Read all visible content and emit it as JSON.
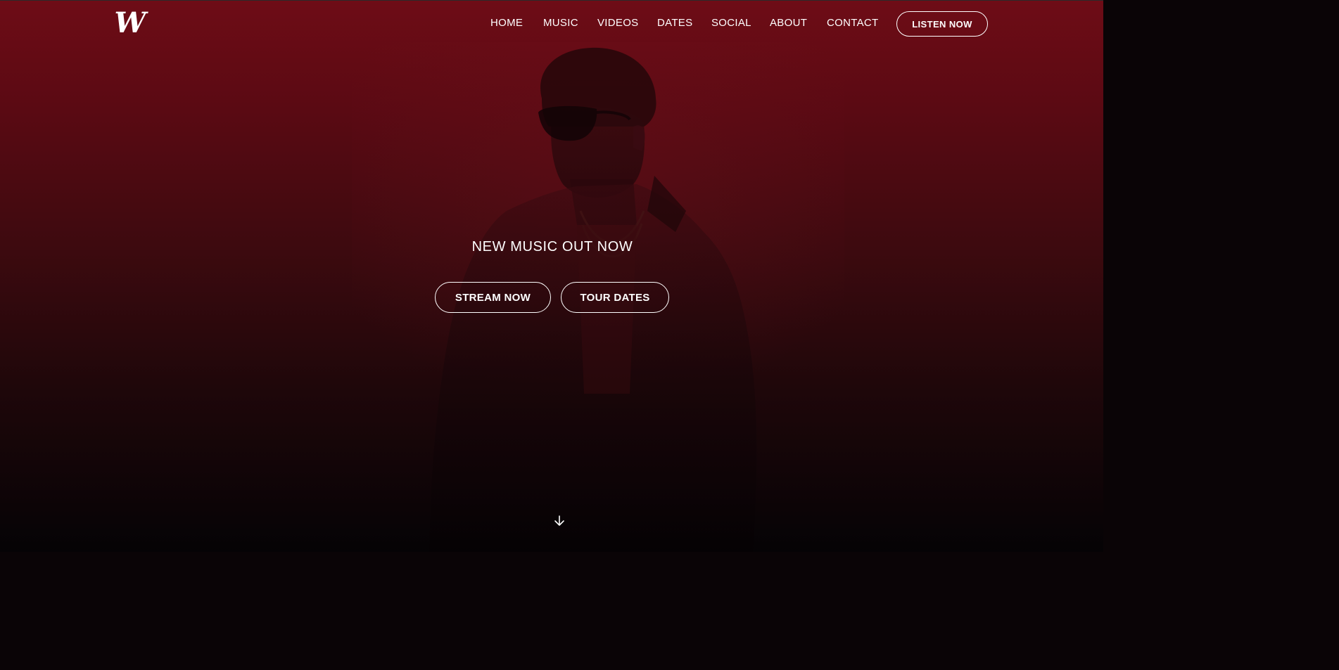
{
  "header": {
    "logo_text": "W",
    "nav": [
      {
        "label": "HOME"
      },
      {
        "label": "MUSIC"
      },
      {
        "label": "VIDEOS"
      },
      {
        "label": "DATES"
      },
      {
        "label": "SOCIAL"
      },
      {
        "label": "ABOUT"
      },
      {
        "label": "CONTACT"
      }
    ],
    "listen_label": "LISTEN NOW"
  },
  "hero": {
    "headline": "NEW MUSIC OUT NOW",
    "stream_label": "STREAM NOW",
    "tour_label": "TOUR DATES",
    "scroll_icon": "arrow-down-icon"
  },
  "colors": {
    "background_top": "#6e0c16",
    "background_bottom": "#050305",
    "text": "#ffffff"
  }
}
